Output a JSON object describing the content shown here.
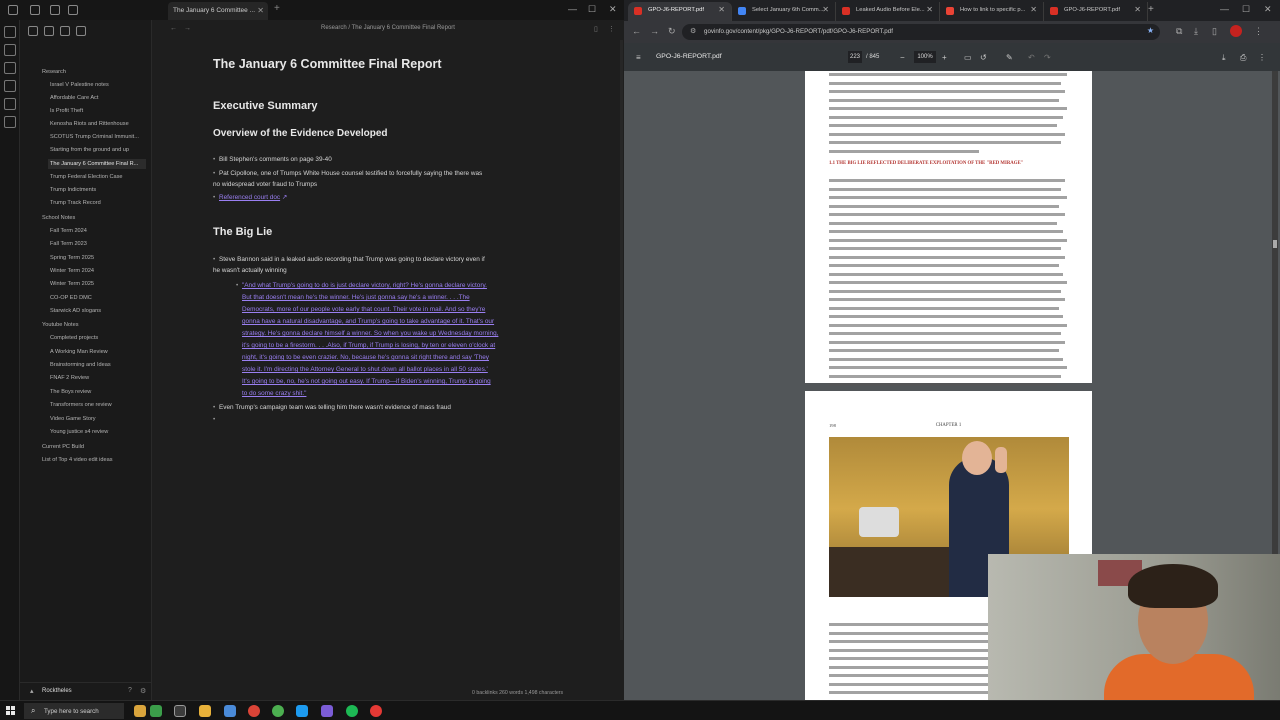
{
  "obsidian": {
    "tab_title": "The January 6 Committee ...",
    "breadcrumb": "Research / The January 6 Committee Final Report",
    "sidebar": {
      "items": [
        {
          "label": "Research",
          "type": "folder"
        },
        {
          "label": "Israel V Palestine notes"
        },
        {
          "label": "Affordable Care Act"
        },
        {
          "label": "Is Profit Theft"
        },
        {
          "label": "Kenosha Riots and Rittenhouse"
        },
        {
          "label": "SCOTUS Trump Criminal Immunit..."
        },
        {
          "label": "Starting from the ground and up"
        },
        {
          "label": "The January 6 Committee Final R...",
          "active": true
        },
        {
          "label": "Trump Federal Election Case"
        },
        {
          "label": "Trump Indictments"
        },
        {
          "label": "Trump Track Record"
        },
        {
          "label": "School Notes",
          "type": "folder"
        },
        {
          "label": "Fall Term 2024"
        },
        {
          "label": "Fall Term 2023"
        },
        {
          "label": "Spring Term 2025"
        },
        {
          "label": "Winter Term 2024"
        },
        {
          "label": "Winter Term 2025"
        },
        {
          "label": "CO-OP ED DMC"
        },
        {
          "label": "Starwick AD slogans"
        },
        {
          "label": "Youtube Notes",
          "type": "folder"
        },
        {
          "label": "Completed projects"
        },
        {
          "label": "A Working Man Review"
        },
        {
          "label": "Brainstorming and Ideas"
        },
        {
          "label": "FNAF 2 Review"
        },
        {
          "label": "The Boys review"
        },
        {
          "label": "Transformers one review"
        },
        {
          "label": "Video Game Story"
        },
        {
          "label": "Young justice s4 review"
        },
        {
          "label": "Current PC Build"
        },
        {
          "label": "List of Top 4 video edit ideas"
        }
      ],
      "vault_name": "Rocktheles"
    },
    "note": {
      "title": "The January 6 Committee Final Report",
      "h_exec": "Executive Summary",
      "h_overview": "Overview of the Evidence Developed",
      "b1": "Bill Stephen's comments on page 39-40",
      "b2_line1": "Pat Cipollone, one of Trumps White House counsel testified to forcefully saying the there was",
      "b2_line2": "no widespread voter fraud to Trumps",
      "b3": "Referenced court doc",
      "h_biglie": "The Big Lie",
      "b4_line1": "Steve Bannon said in a leaked audio recording that Trump was going to declare victory even if",
      "b4_line2": "he wasn't actually winning",
      "quote_lines": [
        "\"And what Trump's going to do is just declare victory, right? He's gonna declare victory.",
        "But that doesn't mean he's the winner. He's just gonna say he's a winner. . . .The",
        "Democrats, more of our people vote early that count. Their vote in mail. And so they're",
        "gonna have a natural disadvantage, and Trump's going to take advantage of it. That's our",
        "strategy. He's gonna declare himself a winner. So when you wake up Wednesday morning,",
        "it's going to be a firestorm. . . .Also, if Trump, if Trump is losing, by ten or eleven o'clock at",
        "night, it's going to be even crazier. No, because he's gonna sit right there and say 'They",
        "stole it. I'm directing the Attorney General to shut down all ballot places in all 50 states.'",
        "It's going to be, no, he's not going out easy. If Trump—if Biden's winning, Trump is going",
        "to do some crazy shit.\""
      ],
      "b5": "Even Trump's campaign team was telling him there wasn't evidence of mass fraud"
    },
    "status": "0 backlinks   260 words  1,498 characters"
  },
  "chrome": {
    "tabs": [
      {
        "label": "GPO-J6-REPORT.pdf",
        "active": true,
        "color": "#d93025"
      },
      {
        "label": "Select January 6th Comm...",
        "color": "#4285f4"
      },
      {
        "label": "Leaked Audio Before Ele...",
        "color": "#d93025"
      },
      {
        "label": "How to link to specific p...",
        "color": "#ea4335"
      },
      {
        "label": "GPO-J6-REPORT.pdf",
        "color": "#d93025"
      }
    ],
    "url": "govinfo.gov/content/pkg/GPO-J6-REPORT/pdf/GPO-J6-REPORT.pdf",
    "pdf": {
      "title": "GPO-J6-REPORT.pdf",
      "page": "223",
      "total": "/ 845",
      "zoom": "100%",
      "section_heading": "1.1  THE BIG LIE REFLECTED DELIBERATE EXPLOITATION OF THE \"RED MIRAGE\"",
      "page_number": "198",
      "chapter": "CHAPTER 1"
    }
  },
  "taskbar": {
    "search_placeholder": "Type here to search"
  }
}
